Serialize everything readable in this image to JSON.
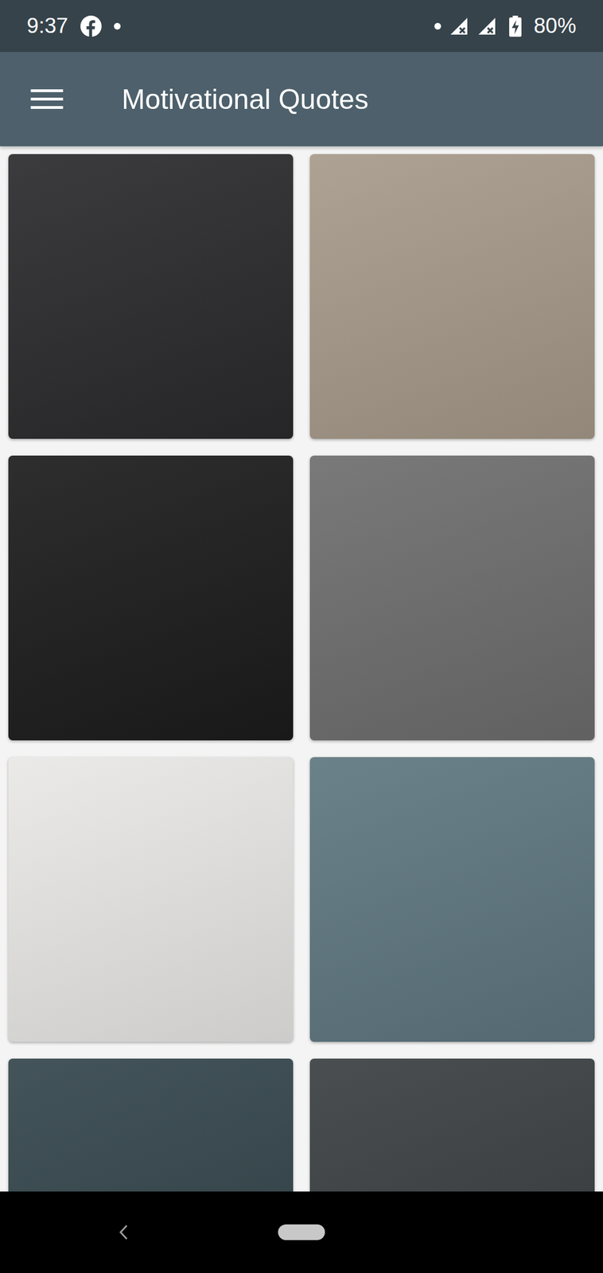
{
  "status_bar": {
    "time": "9:37",
    "battery": "80%"
  },
  "app_bar": {
    "title": "Motivational Quotes"
  },
  "quotes": [
    {
      "color": "#2b2a2c"
    },
    {
      "color": "#a79a8a"
    },
    {
      "color": "#1c1c1c"
    },
    {
      "color": "#6e6e6e"
    },
    {
      "color": "#e9e8e7"
    },
    {
      "color": "#5f7780"
    },
    {
      "color": "#34464c"
    },
    {
      "color": "#3a3f42"
    }
  ]
}
